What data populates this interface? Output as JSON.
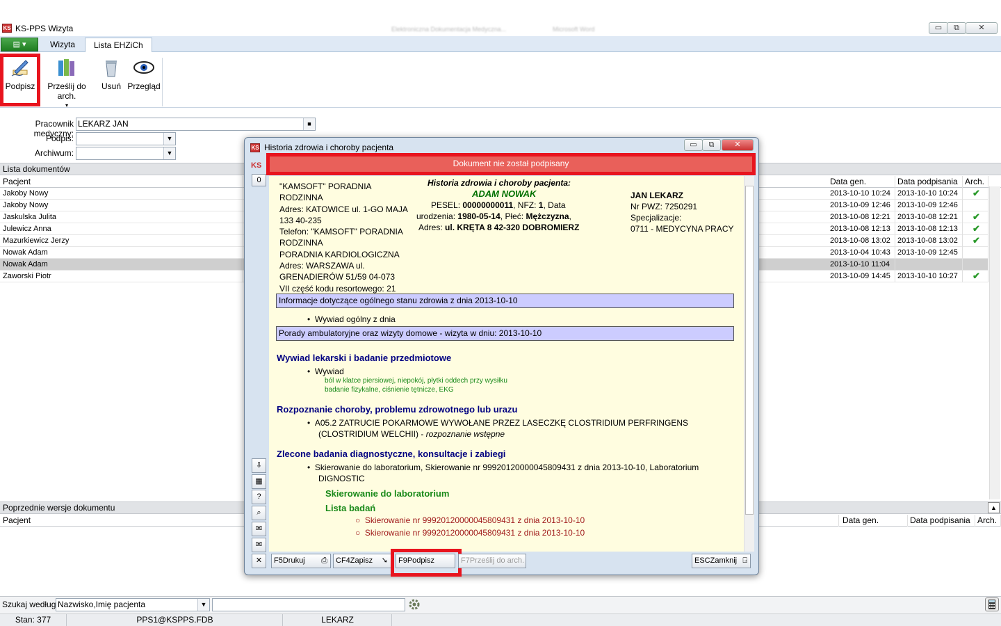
{
  "app": {
    "title": "KS-PPS Wizyta",
    "blurred_title_1": "Elektroniczna Dokumentacja Medyczna...",
    "blurred_title_2": "Microsoft Word",
    "minimize": "▭",
    "restore": "⧉",
    "close": "✕",
    "logo": "KS"
  },
  "ribbon": {
    "menu_label": "▤ ▾",
    "tabs": [
      {
        "label": "Wizyta"
      },
      {
        "label": "Lista EHZiCh"
      }
    ],
    "buttons": [
      {
        "label": "Podpisz"
      },
      {
        "label": "Prześlij do arch."
      },
      {
        "label": "Usuń"
      },
      {
        "label": "Przegląd"
      }
    ],
    "more": "▾"
  },
  "filters": {
    "worker_label": "Pracownik medyczny:",
    "worker_value": "LEKARZ JAN",
    "sign_label": "Podpis:",
    "sign_value": "",
    "archive_label": "Archiwum:",
    "archive_value": "",
    "dropdown": "▼",
    "stop": "■"
  },
  "documents": {
    "section_title": "Lista dokumentów",
    "columns": {
      "patient": "Pacjent",
      "gen": "Data gen.",
      "signed": "Data podpisania",
      "arch": "Arch."
    },
    "rows": [
      {
        "patient": "Jakoby Nowy",
        "gen": "2013-10-10 10:24",
        "signed": "2013-10-10 10:24",
        "arch": "✔"
      },
      {
        "patient": "Jakoby Nowy",
        "gen": "2013-10-09 12:46",
        "signed": "2013-10-09 12:46",
        "arch": ""
      },
      {
        "patient": "Jaskulska Julita",
        "gen": "2013-10-08 12:21",
        "signed": "2013-10-08 12:21",
        "arch": "✔"
      },
      {
        "patient": "Julewicz Anna",
        "gen": "2013-10-08 12:13",
        "signed": "2013-10-08 12:13",
        "arch": "✔"
      },
      {
        "patient": "Mazurkiewicz Jerzy",
        "gen": "2013-10-08 13:02",
        "signed": "2013-10-08 13:02",
        "arch": "✔"
      },
      {
        "patient": "Nowak Adam",
        "gen": "2013-10-04 10:43",
        "signed": "2013-10-09 12:45",
        "arch": ""
      },
      {
        "patient": "Nowak Adam",
        "gen": "2013-10-10 11:04",
        "signed": "",
        "arch": ""
      },
      {
        "patient": "Zaworski Piotr",
        "gen": "2013-10-09 14:45",
        "signed": "2013-10-10 10:27",
        "arch": "✔"
      }
    ],
    "selected_index": 6
  },
  "previous": {
    "section_title": "Poprzednie wersje dokumentu",
    "columns": {
      "patient": "Pacjent",
      "gen": "Data gen.",
      "signed": "Data podpisania",
      "arch": "Arch."
    },
    "collapse": "▲"
  },
  "search": {
    "label": "Szukaj według:",
    "mode": "Nazwisko,Imię pacjenta",
    "query": ""
  },
  "status": {
    "count": "Stan: 377",
    "db": "PPS1@KSPPS.FDB",
    "user": "LEKARZ"
  },
  "dialog": {
    "title": "Historia zdrowia i choroby pacjenta",
    "banner": "Dokument nie został podpisany",
    "page_no": "0",
    "clinic": [
      "\"KAMSOFT\" PORADNIA",
      "RODZINNA",
      "Adres: KATOWICE ul. 1-GO MAJA",
      "133 40-235",
      "Telefon: \"KAMSOFT\" PORADNIA",
      "RODZINNA",
      "PORADNIA KARDIOLOGICZNA",
      "Adres: WARSZAWA ul.",
      "GRENADIERÓW 51/59 04-073",
      "VII część kodu resortowego: 21"
    ],
    "doc_title": "Historia zdrowia i choroby pacjenta:",
    "patient_name": "ADAM NOWAK",
    "patient": {
      "pesel_label": "PESEL:",
      "pesel": "00000000011",
      "nfz_label": ", NFZ:",
      "nfz": "1",
      "date_label": ", Data",
      "birth_label": "urodzenia:",
      "birth": "1980-05-14",
      "sex_label": ", Płeć:",
      "sex": "Mężczyzna",
      "addr_label": "Adres:",
      "addr": "ul. KRĘTA 8 42-320 DOBROMIERZ"
    },
    "doctor": {
      "name": "JAN LEKARZ",
      "pwz": "Nr PWZ: 7250291",
      "spec_label": "Specjalizacje:",
      "spec": "0711 - MEDYCYNA PRACY"
    },
    "info1": "Informacje dotyczące ogólnego stanu zdrowia z dnia 2013-10-10",
    "bullet1": "Wywiad ogólny z dnia",
    "info2": "Porady ambulatoryjne oraz wizyty domowe - wizyta w dniu: 2013-10-10",
    "h1": "Wywiad lekarski i badanie przedmiotowe",
    "b_wywiad": "Wywiad",
    "wywiad_l1": "ból w klatce piersiowej, niepokój, płytki oddech przy wysiłku",
    "wywiad_l2": "badanie fizykalne, ciśnienie tętnicze, EKG",
    "h2": "Rozpoznanie choroby, problemu zdrowotnego lub urazu",
    "diag_l1": "A05.2 ZATRUCIE POKARMOWE WYWOŁANE PRZEZ LASECZKĘ CLOSTRIDIUM PERFRINGENS",
    "diag_l2": "(CLOSTRIDIUM WELCHII) -",
    "diag_type": "rozpoznanie wstępne",
    "h3": "Zlecone badania diagnostyczne, konsultacje i zabiegi",
    "ref_l1": "Skierowanie do laboratorium, Skierowanie nr 99920120000045809431 z dnia 2013-10-10, Laboratorium",
    "ref_l2": "DIGNOSTIC",
    "sub1": "Skierowanie do laboratorium",
    "sub2": "Lista badań",
    "tests": [
      "Skierowanie nr 99920120000045809431 z dnia 2013-10-10",
      "Skierowanie nr 99920120000045809431 z dnia 2013-10-10"
    ],
    "side": {
      "export": "⇩",
      "calc": "▦",
      "help": "?",
      "search": "⌕",
      "email_to": "✉",
      "email": "✉",
      "close": "✕"
    },
    "buttons": {
      "print_key": "F5",
      "print": "Drukuj",
      "save_key": "CF4",
      "save": "Zapisz",
      "sign_key": "F9",
      "sign": "Podpisz",
      "send_key": "F7",
      "send": "Prześlij do arch.",
      "close_key": "ESC",
      "close": "Zamknij"
    }
  },
  "colors": {
    "banner": "#e9605a",
    "highlight": "#e8141e",
    "info_box": "#ccccff",
    "content_bg": "#fffde0",
    "navy": "#000080",
    "green": "#1a8a1a",
    "dark_red": "#a01a1a"
  }
}
